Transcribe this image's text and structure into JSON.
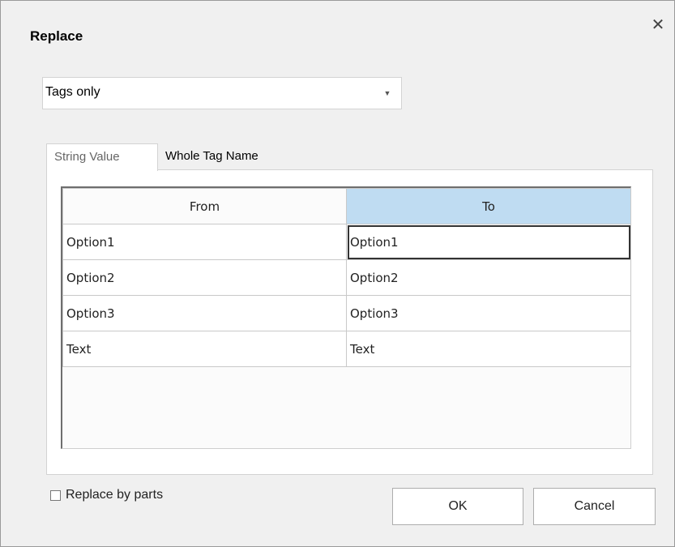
{
  "dialog": {
    "title": "Replace",
    "close_icon": "close-icon"
  },
  "scope_dropdown": {
    "selected": "Tags only",
    "arrow_icon": "chevron-down-icon"
  },
  "tabs": [
    {
      "label": "String Value",
      "active": true
    },
    {
      "label": "Whole Tag Name",
      "active": false
    }
  ],
  "grid": {
    "columns": [
      "From",
      "To"
    ],
    "rows": [
      {
        "from": "Option1",
        "to": "Option1"
      },
      {
        "from": "Option2",
        "to": "Option2"
      },
      {
        "from": "Option3",
        "to": "Option3"
      },
      {
        "from": "Text",
        "to": "Text"
      }
    ]
  },
  "replace_by_parts": {
    "label": "Replace by parts",
    "checked": false
  },
  "buttons": {
    "ok": "OK",
    "cancel": "Cancel"
  },
  "colors": {
    "dialog_background": "#f0f0f0",
    "header_highlight": "#bfdcf2"
  }
}
